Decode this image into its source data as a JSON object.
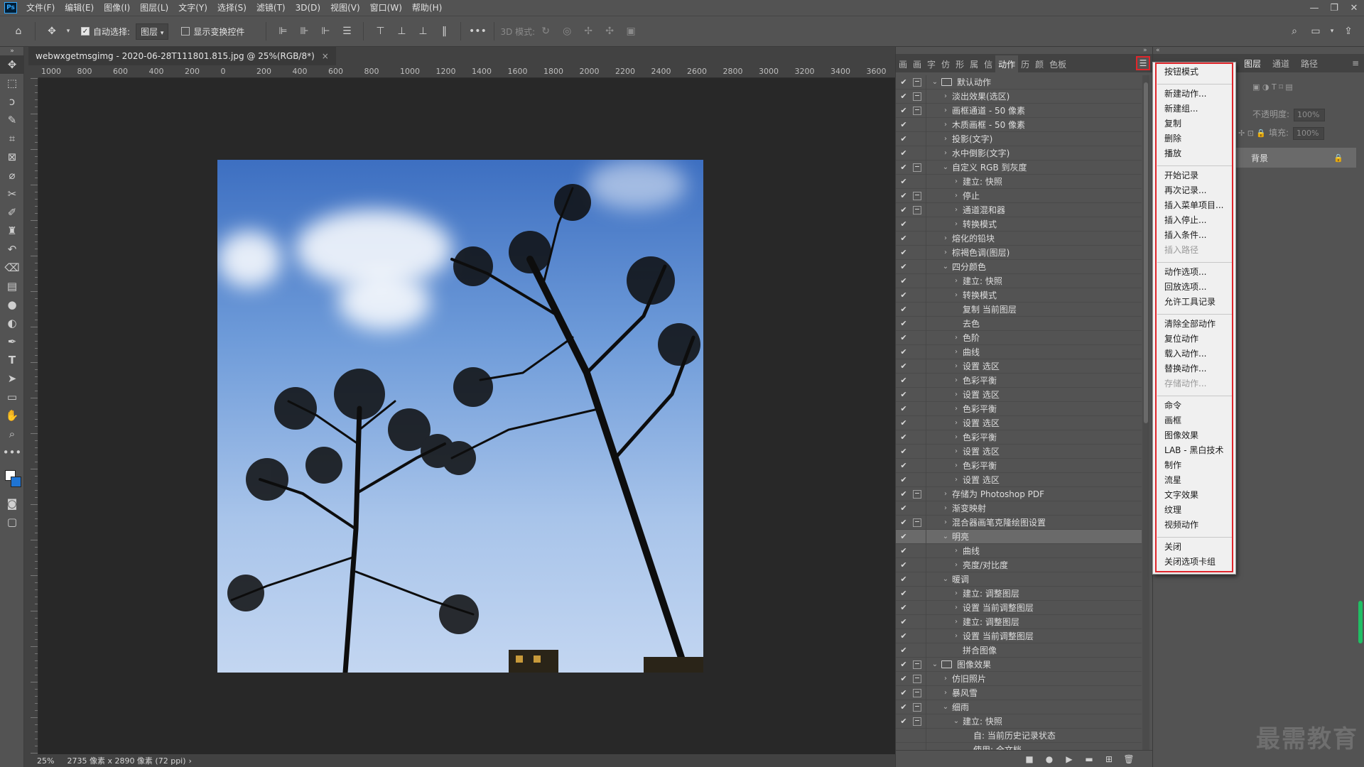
{
  "menubar": {
    "items": [
      "文件(F)",
      "编辑(E)",
      "图像(I)",
      "图层(L)",
      "文字(Y)",
      "选择(S)",
      "滤镜(T)",
      "3D(D)",
      "视图(V)",
      "窗口(W)",
      "帮助(H)"
    ],
    "window_controls": [
      "—",
      "❐",
      "✕"
    ]
  },
  "options": {
    "auto_select_label": "自动选择:",
    "layer_select": "图层",
    "show_transform_label": "显示变换控件",
    "mode_3d_label": "3D 模式:"
  },
  "document": {
    "tab_title": "webwxgetmsgimg - 2020-06-28T111801.815.jpg @ 25%(RGB/8*)",
    "close": "×",
    "ruler_labels": [
      "1000",
      "800",
      "600",
      "400",
      "200",
      "0",
      "200",
      "400",
      "600",
      "800",
      "1000",
      "1200",
      "1400",
      "1600",
      "1800",
      "2000",
      "2200",
      "2400",
      "2600",
      "2800",
      "3000",
      "3200",
      "3400",
      "3600"
    ]
  },
  "status": {
    "zoom": "25%",
    "info": "2735 像素 x 2890 像素 (72 ppi)"
  },
  "panel_tabs": [
    "画",
    "画",
    "字",
    "仿",
    "形",
    "属",
    "信",
    "动作",
    "历",
    "颜",
    "色板"
  ],
  "actions": [
    {
      "label": "默认动作",
      "level": 0,
      "type": "set",
      "open": true,
      "dialog": true
    },
    {
      "label": "淡出效果(选区)",
      "level": 1,
      "type": "action",
      "open": false,
      "dialog": true
    },
    {
      "label": "画框通道 - 50 像素",
      "level": 1,
      "type": "action",
      "open": false,
      "dialog": true
    },
    {
      "label": "木质画框 - 50 像素",
      "level": 1,
      "type": "action",
      "open": false,
      "dialog": false
    },
    {
      "label": "投影(文字)",
      "level": 1,
      "type": "action",
      "open": false,
      "dialog": false
    },
    {
      "label": "水中倒影(文字)",
      "level": 1,
      "type": "action",
      "open": false,
      "dialog": false
    },
    {
      "label": "自定义 RGB 到灰度",
      "level": 1,
      "type": "action",
      "open": true,
      "dialog": true
    },
    {
      "label": "建立: 快照",
      "level": 2,
      "type": "step",
      "open": false,
      "dialog": false
    },
    {
      "label": "停止",
      "level": 2,
      "type": "step",
      "open": false,
      "dialog": true
    },
    {
      "label": "通道混和器",
      "level": 2,
      "type": "step",
      "open": false,
      "dialog": true
    },
    {
      "label": "转换模式",
      "level": 2,
      "type": "step",
      "open": false,
      "dialog": false
    },
    {
      "label": "熔化的铅块",
      "level": 1,
      "type": "action",
      "open": false,
      "dialog": false
    },
    {
      "label": "棕褐色调(图层)",
      "level": 1,
      "type": "action",
      "open": false,
      "dialog": false
    },
    {
      "label": "四分颜色",
      "level": 1,
      "type": "action",
      "open": true,
      "dialog": false
    },
    {
      "label": "建立: 快照",
      "level": 2,
      "type": "step",
      "open": false,
      "dialog": false
    },
    {
      "label": "转换模式",
      "level": 2,
      "type": "step",
      "open": false,
      "dialog": false
    },
    {
      "label": "复制 当前图层",
      "level": 2,
      "type": "leaf",
      "open": false,
      "dialog": false
    },
    {
      "label": "去色",
      "level": 2,
      "type": "leaf",
      "open": false,
      "dialog": false
    },
    {
      "label": "色阶",
      "level": 2,
      "type": "step",
      "open": false,
      "dialog": false
    },
    {
      "label": "曲线",
      "level": 2,
      "type": "step",
      "open": false,
      "dialog": false
    },
    {
      "label": "设置 选区",
      "level": 2,
      "type": "step",
      "open": false,
      "dialog": false
    },
    {
      "label": "色彩平衡",
      "level": 2,
      "type": "step",
      "open": false,
      "dialog": false
    },
    {
      "label": "设置 选区",
      "level": 2,
      "type": "step",
      "open": false,
      "dialog": false
    },
    {
      "label": "色彩平衡",
      "level": 2,
      "type": "step",
      "open": false,
      "dialog": false
    },
    {
      "label": "设置 选区",
      "level": 2,
      "type": "step",
      "open": false,
      "dialog": false
    },
    {
      "label": "色彩平衡",
      "level": 2,
      "type": "step",
      "open": false,
      "dialog": false
    },
    {
      "label": "设置 选区",
      "level": 2,
      "type": "step",
      "open": false,
      "dialog": false
    },
    {
      "label": "色彩平衡",
      "level": 2,
      "type": "step",
      "open": false,
      "dialog": false
    },
    {
      "label": "设置 选区",
      "level": 2,
      "type": "step",
      "open": false,
      "dialog": false
    },
    {
      "label": "存储为 Photoshop PDF",
      "level": 1,
      "type": "action",
      "open": false,
      "dialog": true
    },
    {
      "label": "渐变映射",
      "level": 1,
      "type": "action",
      "open": false,
      "dialog": false
    },
    {
      "label": "混合器画笔克隆绘图设置",
      "level": 1,
      "type": "action",
      "open": false,
      "dialog": true
    },
    {
      "label": "明亮",
      "level": 1,
      "type": "action",
      "open": true,
      "dialog": false,
      "selected": true
    },
    {
      "label": "曲线",
      "level": 2,
      "type": "step",
      "open": false,
      "dialog": false
    },
    {
      "label": "亮度/对比度",
      "level": 2,
      "type": "step",
      "open": false,
      "dialog": false
    },
    {
      "label": "暖调",
      "level": 1,
      "type": "action",
      "open": true,
      "dialog": false
    },
    {
      "label": "建立: 调整图层",
      "level": 2,
      "type": "step",
      "open": false,
      "dialog": false
    },
    {
      "label": "设置 当前调整图层",
      "level": 2,
      "type": "step",
      "open": false,
      "dialog": false
    },
    {
      "label": "建立: 调整图层",
      "level": 2,
      "type": "step",
      "open": false,
      "dialog": false
    },
    {
      "label": "设置 当前调整图层",
      "level": 2,
      "type": "step",
      "open": false,
      "dialog": false
    },
    {
      "label": "拼合图像",
      "level": 2,
      "type": "leaf",
      "open": false,
      "dialog": false
    },
    {
      "label": "图像效果",
      "level": 0,
      "type": "set",
      "open": true,
      "dialog": true
    },
    {
      "label": "仿旧照片",
      "level": 1,
      "type": "action",
      "open": false,
      "dialog": true
    },
    {
      "label": "暴风雪",
      "level": 1,
      "type": "action",
      "open": false,
      "dialog": true
    },
    {
      "label": "细雨",
      "level": 1,
      "type": "action",
      "open": true,
      "dialog": true
    },
    {
      "label": "建立: 快照",
      "level": 2,
      "type": "step",
      "open": true,
      "dialog": true
    },
    {
      "label": "自: 当前历史记录状态",
      "level": 3,
      "type": "leaf",
      "open": false,
      "dialog": false
    },
    {
      "label": "使用: 全文档",
      "level": 3,
      "type": "leaf",
      "open": false,
      "dialog": false
    }
  ],
  "flyout": [
    {
      "label": "按钮模式",
      "disabled": false
    },
    {
      "sep": true
    },
    {
      "label": "新建动作...",
      "disabled": false
    },
    {
      "label": "新建组...",
      "disabled": false
    },
    {
      "label": "复制",
      "disabled": false
    },
    {
      "label": "删除",
      "disabled": false
    },
    {
      "label": "播放",
      "disabled": false
    },
    {
      "sep": true
    },
    {
      "label": "开始记录",
      "disabled": false
    },
    {
      "label": "再次记录...",
      "disabled": false
    },
    {
      "label": "插入菜单项目...",
      "disabled": false
    },
    {
      "label": "插入停止...",
      "disabled": false
    },
    {
      "label": "插入条件...",
      "disabled": false
    },
    {
      "label": "插入路径",
      "disabled": true
    },
    {
      "sep": true
    },
    {
      "label": "动作选项...",
      "disabled": false
    },
    {
      "label": "回放选项...",
      "disabled": false
    },
    {
      "label": "允许工具记录",
      "disabled": false
    },
    {
      "sep": true
    },
    {
      "label": "清除全部动作",
      "disabled": false
    },
    {
      "label": "复位动作",
      "disabled": false
    },
    {
      "label": "载入动作...",
      "disabled": false
    },
    {
      "label": "替换动作...",
      "disabled": false
    },
    {
      "label": "存储动作...",
      "disabled": true
    },
    {
      "sep": true
    },
    {
      "label": "命令",
      "disabled": false
    },
    {
      "label": "画框",
      "disabled": false
    },
    {
      "label": "图像效果",
      "disabled": false
    },
    {
      "label": "LAB - 黑白技术",
      "disabled": false
    },
    {
      "label": "制作",
      "disabled": false
    },
    {
      "label": "流星",
      "disabled": false
    },
    {
      "label": "文字效果",
      "disabled": false
    },
    {
      "label": "纹理",
      "disabled": false
    },
    {
      "label": "视频动作",
      "disabled": false
    },
    {
      "sep": true
    },
    {
      "label": "关闭",
      "disabled": false
    },
    {
      "label": "关闭选项卡组",
      "disabled": false
    }
  ],
  "right_panel": {
    "tabs": [
      "图层",
      "通道",
      "路径"
    ],
    "opacity_label": "不透明度:",
    "opacity_value": "100%",
    "fill_label": "填充:",
    "fill_value": "100%",
    "layer_name": "背景"
  },
  "watermark": "最需教育",
  "colors": {
    "accent_red": "#e0262b",
    "fg_swatch": "#ffffff",
    "bg_swatch": "#1f74d3"
  }
}
